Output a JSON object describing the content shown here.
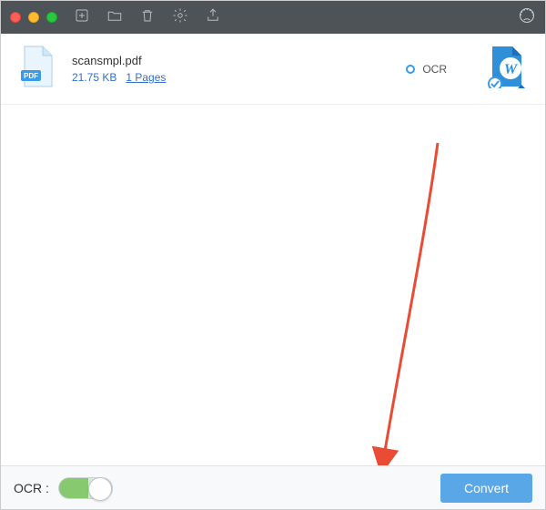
{
  "file": {
    "name": "scansmpl.pdf",
    "size": "21.75 KB",
    "pages": "1 Pages"
  },
  "ocr_inline_label": "OCR",
  "bottom": {
    "ocr_label": "OCR :",
    "convert_label": "Convert"
  },
  "colors": {
    "accent": "#5aa7e8",
    "link": "#2f6fd4",
    "switch_on": "#86c96e",
    "arrow": "#e94b35"
  }
}
